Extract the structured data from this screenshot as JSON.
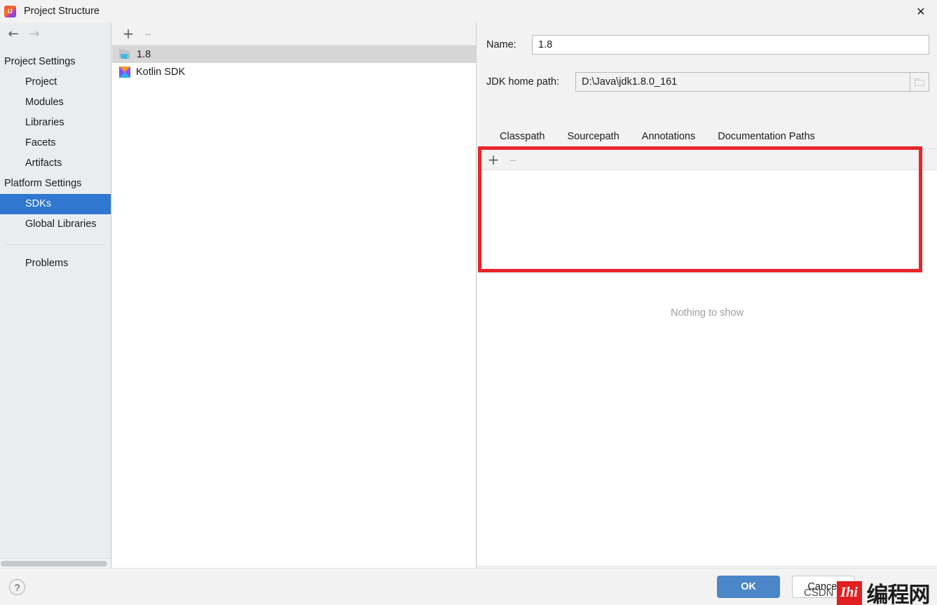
{
  "window": {
    "title": "Project Structure",
    "app_icon": "intellij-idea-icon",
    "close_icon": "✕"
  },
  "nav": {
    "back_icon": "←",
    "forward_icon": "→"
  },
  "sidebar": {
    "groups": [
      {
        "label": "Project Settings",
        "items": [
          {
            "label": "Project",
            "selected": false
          },
          {
            "label": "Modules",
            "selected": false
          },
          {
            "label": "Libraries",
            "selected": false
          },
          {
            "label": "Facets",
            "selected": false
          },
          {
            "label": "Artifacts",
            "selected": false
          }
        ]
      },
      {
        "label": "Platform Settings",
        "items": [
          {
            "label": "SDKs",
            "selected": true
          },
          {
            "label": "Global Libraries",
            "selected": false
          }
        ]
      }
    ],
    "footer_item": {
      "label": "Problems"
    },
    "selected_color": "#2f77d0"
  },
  "sdk_list": {
    "toolbar": {
      "add_label": "+",
      "remove_label": "–"
    },
    "rows": [
      {
        "label": "1.8",
        "icon": "jdk-folder-icon",
        "selected": true
      },
      {
        "label": "Kotlin SDK",
        "icon": "kotlin-icon",
        "selected": false
      }
    ]
  },
  "detail": {
    "name_label": "Name:",
    "name_value": "1.8",
    "name_placeholder": "",
    "jdk_path_label": "JDK home path:",
    "jdk_path_value": "D:\\Java\\jdk1.8.0_161",
    "jdk_path_placeholder": "",
    "browse_icon": "folder-icon",
    "tabs": [
      {
        "label": "Classpath",
        "active": false
      },
      {
        "label": "Sourcepath",
        "active": true
      },
      {
        "label": "Annotations",
        "active": false
      },
      {
        "label": "Documentation Paths",
        "active": false
      }
    ],
    "active_tab_color": "#3c78c8",
    "panel_toolbar": {
      "add_label": "+",
      "remove_label": "–"
    },
    "empty_message": "Nothing to show"
  },
  "annotation": {
    "highlight_color": "#e8262a",
    "shape": "rectangle"
  },
  "bottom": {
    "help_label": "?",
    "ok_label": "OK",
    "cancel_label": "Cancel",
    "ok_color": "#4a86c8"
  },
  "watermark": {
    "logo_text": "Ihi",
    "text": "编程网",
    "overlay_text": "CSDN",
    "logo_color": "#e02020"
  }
}
